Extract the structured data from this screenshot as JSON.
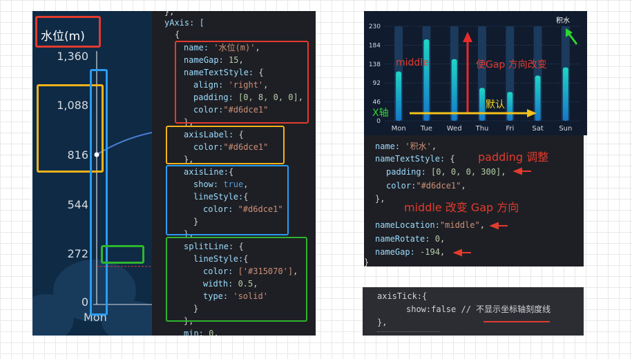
{
  "left_chart": {
    "title": "水位(m)",
    "y_ticks": [
      "1,360",
      "1,088",
      "816",
      "544",
      "272",
      "0"
    ],
    "x_tick": "Mon"
  },
  "left_code": {
    "l0": "},",
    "l1": "yAxis: [",
    "l2": "{",
    "l3_key": "name: ",
    "l3_val": "'水位(m)'",
    "l3_end": ",",
    "l4_key": "nameGap: ",
    "l4_val": "15",
    "l4_end": ",",
    "l5_key": "nameTextStyle: ",
    "l5_end": "{",
    "l6_key": "align: ",
    "l6_val": "'right'",
    "l6_end": ",",
    "l7_key": "padding: ",
    "l7_val": "[0, 8, 0, 0]",
    "l7_end": ",",
    "l8_key": "color:",
    "l8_val": "\"#d6dce1\"",
    "l9": "},",
    "l10_key": "axisLabel: ",
    "l10_end": "{",
    "l11_key": "color:",
    "l11_val": "\"#d6dce1\"",
    "l12": "},",
    "l13_key": "axisLine:",
    "l13_end": "{",
    "l14_key": "show: ",
    "l14_val": "true",
    "l14_end": ",",
    "l15_key": "lineStyle:",
    "l15_end": "{",
    "l16_key": "color: ",
    "l16_val": "\"#d6dce1\"",
    "l17": "}",
    "l18": "},",
    "l19_key": "splitLine: ",
    "l19_end": "{",
    "l20_key": "lineStyle:",
    "l20_end": "{",
    "l21_key": "color: ",
    "l21_val": "['#315070']",
    "l21_end": ",",
    "l22_key": "width: ",
    "l22_val": "0.5",
    "l22_end": ",",
    "l23_key": "type: ",
    "l23_val": "'solid'",
    "l24": "}",
    "l25": "},",
    "l26_key": "min: ",
    "l26_val": "0",
    "l26_end": ","
  },
  "right_chart": {
    "name": "积水",
    "y_ticks": [
      "230",
      "184",
      "138",
      "92",
      "46",
      "0"
    ],
    "x_ticks": [
      "Mon",
      "Tue",
      "Wed",
      "Thu",
      "Fri",
      "Sat",
      "Sun"
    ],
    "annotation_middle": "middle",
    "annotation_gap": "使Gap 方向改变",
    "annotation_default": "默认",
    "annotation_xaxis": "X轴"
  },
  "right_code": {
    "r0_key": "name: ",
    "r0_val": "'积水'",
    "r0_end": ",",
    "r1_key": "nameTextStyle: ",
    "r1_end": "{",
    "r2_key": "padding: ",
    "r2_val": "[0, 0, 0, 300]",
    "r2_end": ",",
    "r3_key": "color:",
    "r3_val": "\"#d6dce1\"",
    "r3_end": ",",
    "r4": "},",
    "r5_key": "nameLocation:",
    "r5_val": "\"middle\"",
    "r5_end": ",",
    "r6_key": "nameRotate: ",
    "r6_val": "0",
    "r6_end": ",",
    "r7_key": "nameGap: ",
    "r7_val": "-194",
    "r7_end": ",",
    "note_padding": "padding 调整",
    "note_middle": "middle  改变 Gap 方向"
  },
  "tick_code": {
    "t0": "axisTick:{",
    "t1_key": "show:",
    "t1_val": "false",
    "t1_comment": " // 不显示坐标轴刻度线",
    "t2": "},"
  },
  "chart_data": {
    "type": "bar",
    "categories": [
      "Mon",
      "Tue",
      "Wed",
      "Thu",
      "Fri",
      "Sat",
      "Sun"
    ],
    "series": [
      {
        "name": "积水",
        "values": [
          120,
          198,
          150,
          80,
          70,
          110,
          130
        ]
      }
    ],
    "ylim": [
      0,
      230
    ]
  },
  "colors": {
    "highlight_red": "#e33b2e",
    "highlight_yellow": "#f5b31a",
    "highlight_blue": "#2a9df4",
    "highlight_green": "#2fb52f",
    "bar_top": "#1dd6c4",
    "bar_bottom": "#1577c9"
  }
}
